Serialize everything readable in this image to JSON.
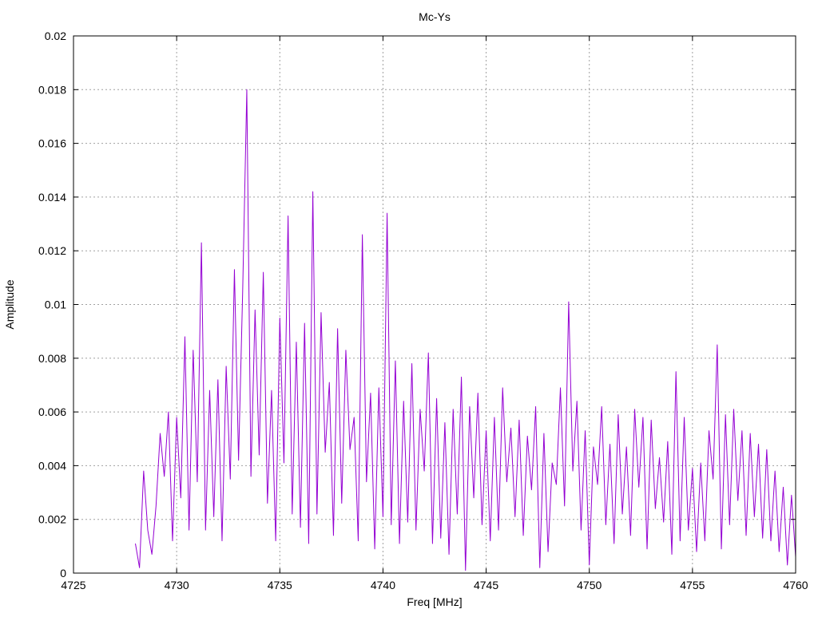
{
  "chart_data": {
    "type": "line",
    "title": "Mc-Ys",
    "xlabel": "Freq [MHz]",
    "ylabel": "Amplitude",
    "xlim": [
      4725,
      4760
    ],
    "ylim": [
      0,
      0.02
    ],
    "x_ticks": [
      4725,
      4730,
      4735,
      4740,
      4745,
      4750,
      4755,
      4760
    ],
    "x_tick_labels": [
      "4725",
      "4730",
      "4735",
      "4740",
      "4745",
      "4750",
      "4755",
      "4760"
    ],
    "y_ticks": [
      0,
      0.002,
      0.004,
      0.006,
      0.008,
      0.01,
      0.012,
      0.014,
      0.016,
      0.018,
      0.02
    ],
    "y_tick_labels": [
      "0",
      "0.002",
      "0.004",
      "0.006",
      "0.008",
      "0.01",
      "0.012",
      "0.014",
      "0.016",
      "0.018",
      "0.02"
    ],
    "grid": true,
    "series": [
      {
        "color": "#9400d3",
        "x": [
          4728.0,
          4728.2,
          4728.4,
          4728.6,
          4728.8,
          4729.0,
          4729.2,
          4729.4,
          4729.6,
          4729.8,
          4730.0,
          4730.2,
          4730.4,
          4730.6,
          4730.8,
          4731.0,
          4731.2,
          4731.4,
          4731.6,
          4731.8,
          4732.0,
          4732.2,
          4732.4,
          4732.6,
          4732.8,
          4733.0,
          4733.2,
          4733.4,
          4733.6,
          4733.8,
          4734.0,
          4734.2,
          4734.4,
          4734.6,
          4734.8,
          4735.0,
          4735.2,
          4735.4,
          4735.6,
          4735.8,
          4736.0,
          4736.2,
          4736.4,
          4736.6,
          4736.8,
          4737.0,
          4737.2,
          4737.4,
          4737.6,
          4737.8,
          4738.0,
          4738.2,
          4738.4,
          4738.6,
          4738.8,
          4739.0,
          4739.2,
          4739.4,
          4739.6,
          4739.8,
          4740.0,
          4740.2,
          4740.4,
          4740.6,
          4740.8,
          4741.0,
          4741.2,
          4741.4,
          4741.6,
          4741.8,
          4742.0,
          4742.2,
          4742.4,
          4742.6,
          4742.8,
          4743.0,
          4743.2,
          4743.4,
          4743.6,
          4743.8,
          4744.0,
          4744.2,
          4744.4,
          4744.6,
          4744.8,
          4745.0,
          4745.2,
          4745.4,
          4745.6,
          4745.8,
          4746.0,
          4746.2,
          4746.4,
          4746.6,
          4746.8,
          4747.0,
          4747.2,
          4747.4,
          4747.6,
          4747.8,
          4748.0,
          4748.2,
          4748.4,
          4748.6,
          4748.8,
          4749.0,
          4749.2,
          4749.4,
          4749.6,
          4749.8,
          4750.0,
          4750.2,
          4750.4,
          4750.6,
          4750.8,
          4751.0,
          4751.2,
          4751.4,
          4751.6,
          4751.8,
          4752.0,
          4752.2,
          4752.4,
          4752.6,
          4752.8,
          4753.0,
          4753.2,
          4753.4,
          4753.6,
          4753.8,
          4754.0,
          4754.2,
          4754.4,
          4754.6,
          4754.8,
          4755.0,
          4755.2,
          4755.4,
          4755.6,
          4755.8,
          4756.0,
          4756.2,
          4756.4,
          4756.6,
          4756.8,
          4757.0,
          4757.2,
          4757.4,
          4757.6,
          4757.8,
          4758.0,
          4758.2,
          4758.4,
          4758.6,
          4758.8,
          4759.0,
          4759.2,
          4759.4,
          4759.6,
          4759.8,
          4760.0
        ],
        "y": [
          0.0011,
          0.0002,
          0.0038,
          0.0016,
          0.0007,
          0.0025,
          0.0052,
          0.0036,
          0.006,
          0.0012,
          0.0058,
          0.0028,
          0.0088,
          0.0016,
          0.0083,
          0.0034,
          0.0123,
          0.0016,
          0.0068,
          0.0021,
          0.0072,
          0.0012,
          0.0077,
          0.0035,
          0.0113,
          0.0042,
          0.0105,
          0.018,
          0.0036,
          0.0098,
          0.0044,
          0.0112,
          0.0026,
          0.0068,
          0.0012,
          0.0095,
          0.0041,
          0.0133,
          0.0022,
          0.0086,
          0.0017,
          0.0093,
          0.0011,
          0.0142,
          0.0022,
          0.0097,
          0.0045,
          0.0071,
          0.0014,
          0.0091,
          0.0026,
          0.0083,
          0.0046,
          0.0058,
          0.0012,
          0.0126,
          0.0034,
          0.0067,
          0.0009,
          0.0069,
          0.0021,
          0.0134,
          0.0018,
          0.0079,
          0.0011,
          0.0064,
          0.0019,
          0.0078,
          0.0016,
          0.0061,
          0.0038,
          0.0082,
          0.0011,
          0.0065,
          0.0013,
          0.0056,
          0.0007,
          0.0061,
          0.0022,
          0.0073,
          0.0001,
          0.0062,
          0.0028,
          0.0067,
          0.0018,
          0.0053,
          0.0012,
          0.0058,
          0.0016,
          0.0069,
          0.0034,
          0.0054,
          0.0021,
          0.0057,
          0.0014,
          0.0051,
          0.0031,
          0.0062,
          0.0002,
          0.0052,
          0.0008,
          0.0041,
          0.0033,
          0.0069,
          0.0025,
          0.0101,
          0.0038,
          0.0064,
          0.0016,
          0.0053,
          0.0003,
          0.0047,
          0.0033,
          0.0062,
          0.0018,
          0.0048,
          0.0011,
          0.0059,
          0.0022,
          0.0047,
          0.0014,
          0.0061,
          0.0032,
          0.0058,
          0.0009,
          0.0057,
          0.0024,
          0.0043,
          0.0019,
          0.0049,
          0.0007,
          0.0075,
          0.0012,
          0.0058,
          0.0016,
          0.0039,
          0.0008,
          0.0041,
          0.0012,
          0.0053,
          0.0035,
          0.0085,
          0.0009,
          0.0059,
          0.0018,
          0.0061,
          0.0027,
          0.0053,
          0.0014,
          0.0052,
          0.0021,
          0.0048,
          0.0013,
          0.0046,
          0.0012,
          0.0038,
          0.0008,
          0.0032,
          0.0003,
          0.0029,
          0.0006
        ]
      }
    ]
  }
}
